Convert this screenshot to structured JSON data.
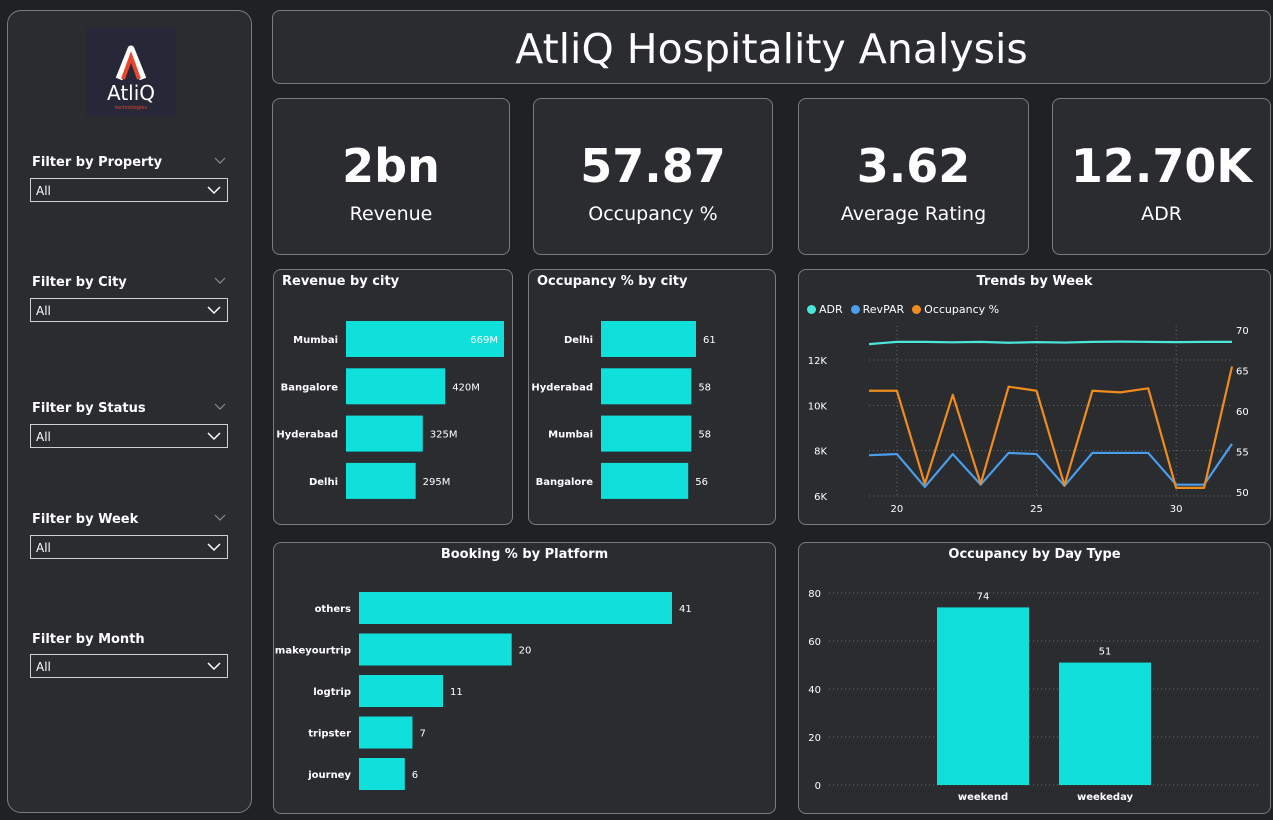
{
  "sidebar": {
    "logo_text": "AtliQ",
    "logo_subtext": "technologies",
    "filters": [
      {
        "label": "Filter by Property",
        "value": "All"
      },
      {
        "label": "Filter by City",
        "value": "All"
      },
      {
        "label": "Filter by Status",
        "value": "All"
      },
      {
        "label": "Filter by Week",
        "value": "All"
      },
      {
        "label": "Filter by Month",
        "value": "All"
      }
    ]
  },
  "header": {
    "title": "AtliQ Hospitality Analysis"
  },
  "kpis": [
    {
      "value": "2bn",
      "label": "Revenue"
    },
    {
      "value": "57.87",
      "label": "Occupancy %"
    },
    {
      "value": "3.62",
      "label": "Average Rating"
    },
    {
      "value": "12.70K",
      "label": "ADR"
    }
  ],
  "colors": {
    "bar": "#10e0dc",
    "adr": "#4ae8dc",
    "revpar": "#4a9eec",
    "occupancy": "#f08c1e",
    "panel": "#2a2c30",
    "background": "#1f2124"
  },
  "chart_data": [
    {
      "id": "revenue_by_city",
      "type": "bar",
      "orientation": "horizontal",
      "title": "Revenue by city",
      "categories": [
        "Mumbai",
        "Bangalore",
        "Hyderabad",
        "Delhi"
      ],
      "values": [
        669,
        420,
        325,
        295
      ],
      "labels": [
        "669M",
        "420M",
        "325M",
        "295M"
      ],
      "xlim": [
        0,
        669
      ]
    },
    {
      "id": "occupancy_by_city",
      "type": "bar",
      "orientation": "horizontal",
      "title": "Occupancy % by city",
      "categories": [
        "Delhi",
        "Hyderabad",
        "Mumbai",
        "Bangalore"
      ],
      "values": [
        61,
        58,
        58,
        56
      ],
      "labels": [
        "61",
        "58",
        "58",
        "56"
      ],
      "xlim": [
        0,
        61
      ]
    },
    {
      "id": "trends_by_week",
      "type": "line",
      "title": "Trends by Week",
      "x": [
        19,
        20,
        21,
        22,
        23,
        24,
        25,
        26,
        27,
        28,
        29,
        30,
        31,
        32
      ],
      "xticks": [
        20,
        25,
        30
      ],
      "series": [
        {
          "name": "ADR",
          "axis": "left",
          "values": [
            12700,
            12800,
            12800,
            12780,
            12800,
            12760,
            12790,
            12770,
            12800,
            12810,
            12800,
            12790,
            12800,
            12800
          ]
        },
        {
          "name": "RevPAR",
          "axis": "left",
          "values": [
            7800,
            7850,
            6400,
            7850,
            6500,
            7900,
            7850,
            6450,
            7900,
            7900,
            7900,
            6500,
            6500,
            8300
          ]
        },
        {
          "name": "Occupancy %",
          "axis": "right",
          "values": [
            62.5,
            62.5,
            51,
            62,
            51,
            63,
            62.5,
            50.8,
            62.5,
            62.3,
            62.8,
            50.5,
            50.5,
            65.5
          ]
        }
      ],
      "ylim_left": [
        6000,
        13500
      ],
      "yticks_left": [
        6000,
        8000,
        10000,
        12000
      ],
      "yticks_left_labels": [
        "6K",
        "8K",
        "10K",
        "12K"
      ],
      "ylim_right": [
        49.5,
        70.5
      ],
      "yticks_right": [
        50,
        55,
        60,
        65,
        70
      ],
      "legend_position": "top-left"
    },
    {
      "id": "booking_by_platform",
      "type": "bar",
      "orientation": "horizontal",
      "title": "Booking % by Platform",
      "categories": [
        "others",
        "makeyourtrip",
        "logtrip",
        "tripster",
        "journey"
      ],
      "values": [
        41,
        20,
        11,
        7,
        6
      ],
      "labels": [
        "41",
        "20",
        "11",
        "7",
        "6"
      ],
      "xlim": [
        0,
        41
      ]
    },
    {
      "id": "occupancy_by_day_type",
      "type": "bar",
      "orientation": "vertical",
      "title": "Occupancy by Day Type",
      "categories": [
        "weekend",
        "weekeday"
      ],
      "values": [
        74,
        51
      ],
      "labels": [
        "74",
        "51"
      ],
      "ylim": [
        0,
        85
      ],
      "yticks": [
        0,
        20,
        40,
        60,
        80
      ]
    }
  ]
}
